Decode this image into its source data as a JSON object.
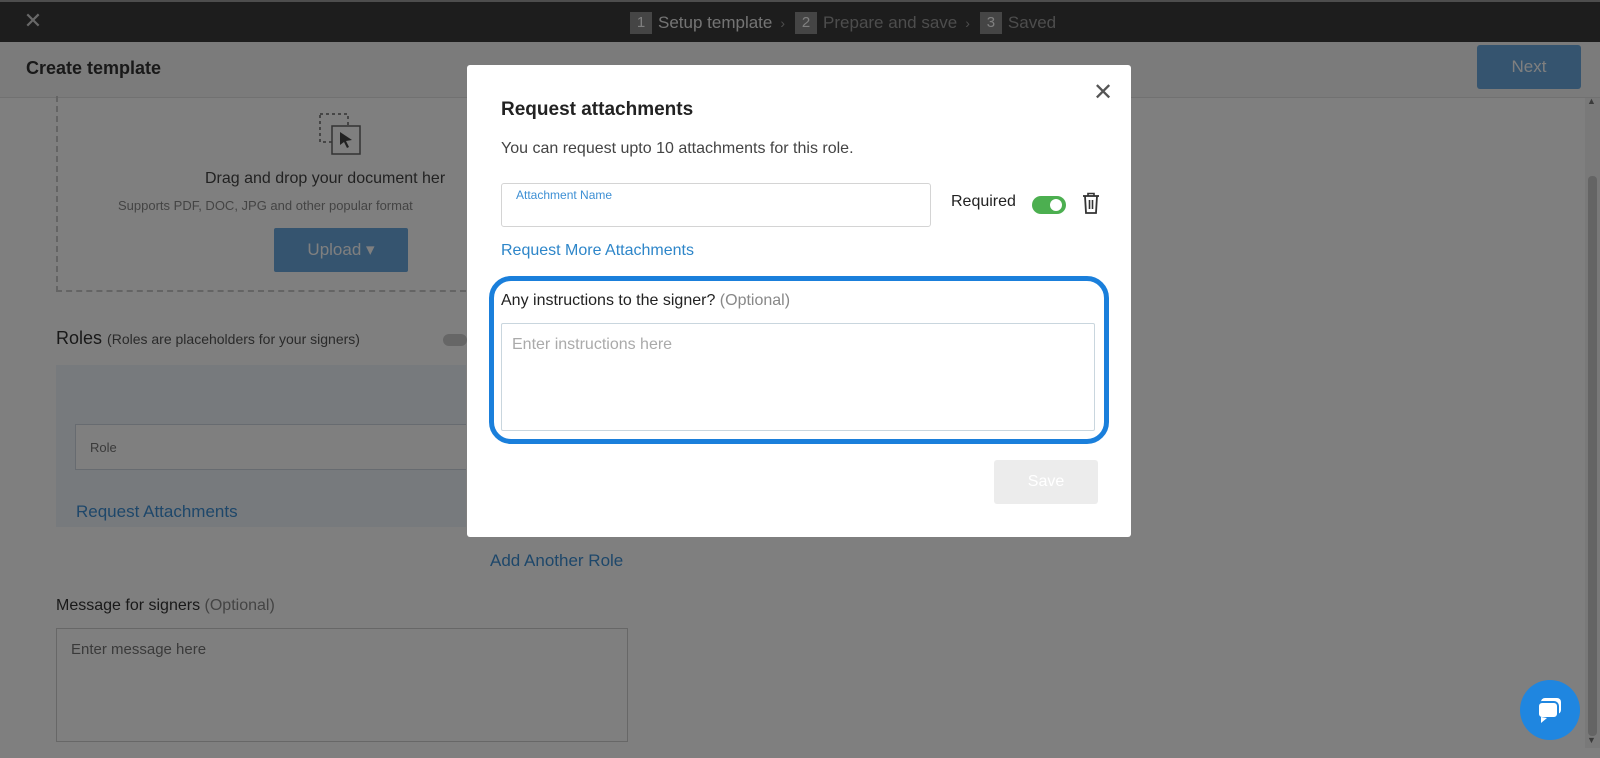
{
  "topbar": {
    "steps": [
      {
        "num": "1",
        "label": "Setup template"
      },
      {
        "num": "2",
        "label": "Prepare and save"
      },
      {
        "num": "3",
        "label": "Saved"
      }
    ]
  },
  "header": {
    "title": "Create template",
    "next_label": "Next"
  },
  "upload": {
    "drop_text": "Drag and drop your document her",
    "supports_text": "Supports PDF, DOC, JPG and other popular format",
    "upload_label": "Upload ▾"
  },
  "roles": {
    "title": "Roles",
    "subtitle": "(Roles are placeholders for your signers)",
    "role_placeholder": "Role",
    "request_attachments": "Request Attachments",
    "add_role": "Add Another Role"
  },
  "message": {
    "label": "Message for signers",
    "optional": "(Optional)",
    "placeholder": "Enter message here"
  },
  "modal": {
    "title": "Request attachments",
    "description": "You can request upto 10 attachments for this role.",
    "attachment_name_label": "Attachment Name",
    "attachment_name_value": "",
    "required_label": "Required",
    "required_on": true,
    "more_link": "Request More Attachments",
    "instructions_label": "Any instructions to the signer?",
    "instructions_optional": "(Optional)",
    "instructions_placeholder": "Enter instructions here",
    "save_label": "Save"
  },
  "colors": {
    "accent": "#1a7fdb",
    "link": "#2e86c9",
    "toggle_on": "#4caf50",
    "primary_button": "#6aa9df"
  }
}
